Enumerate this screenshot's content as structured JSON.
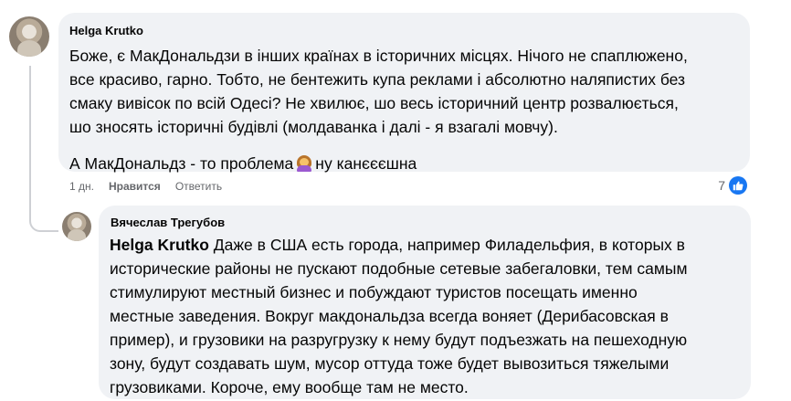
{
  "comment1": {
    "author": "Helga Krutko",
    "lines": [
      "Боже, є МакДональдзи в інших країнах в історичних місцях. Нічого не спаплюжено,",
      "все красиво, гарно. Тобто, не бентежить купа реклами і абсолютно наляпистих без",
      "смаку вивісок по всій Одесі? Не хвилює, шо весь історичний центр розвалюється,",
      "шо зносять історичні будівлі (молдаванка і далі - я взагалі мовчу)."
    ],
    "last_line_before": "А МакДональдз - то проблема",
    "last_line_after": "ну канєєєшна",
    "emoji_icon": "woman-facepalming-emoji",
    "time": "1 дн.",
    "like_label": "Нравится",
    "reply_label": "Ответить",
    "reaction_count": "7",
    "reaction_icon": "like-icon"
  },
  "comment2": {
    "author": "Вячеслав Трегубов",
    "mention": "Helga Krutko",
    "first_line_rest": " Даже в США есть города, например Филадельфия, в которых в",
    "lines": [
      "исторические районы не пускают подобные сетевые забегаловки, тем самым",
      "стимулируют местный бизнес и побуждают туристов посещать именно",
      "местные заведения. Вокруг макдональдза всегда воняет (Дерибасовская в",
      "пример), и грузовики на разругрузку к нему будут подъезжать на пешеходную",
      "зону, будут создавать шум, мусор оттуда тоже будет вывозиться тяжелыми",
      "грузовиками. Короче, ему вообще там не место."
    ]
  },
  "colors": {
    "bubble": "#f0f2f5",
    "accent": "#1877f2",
    "meta_text": "#65676b"
  }
}
